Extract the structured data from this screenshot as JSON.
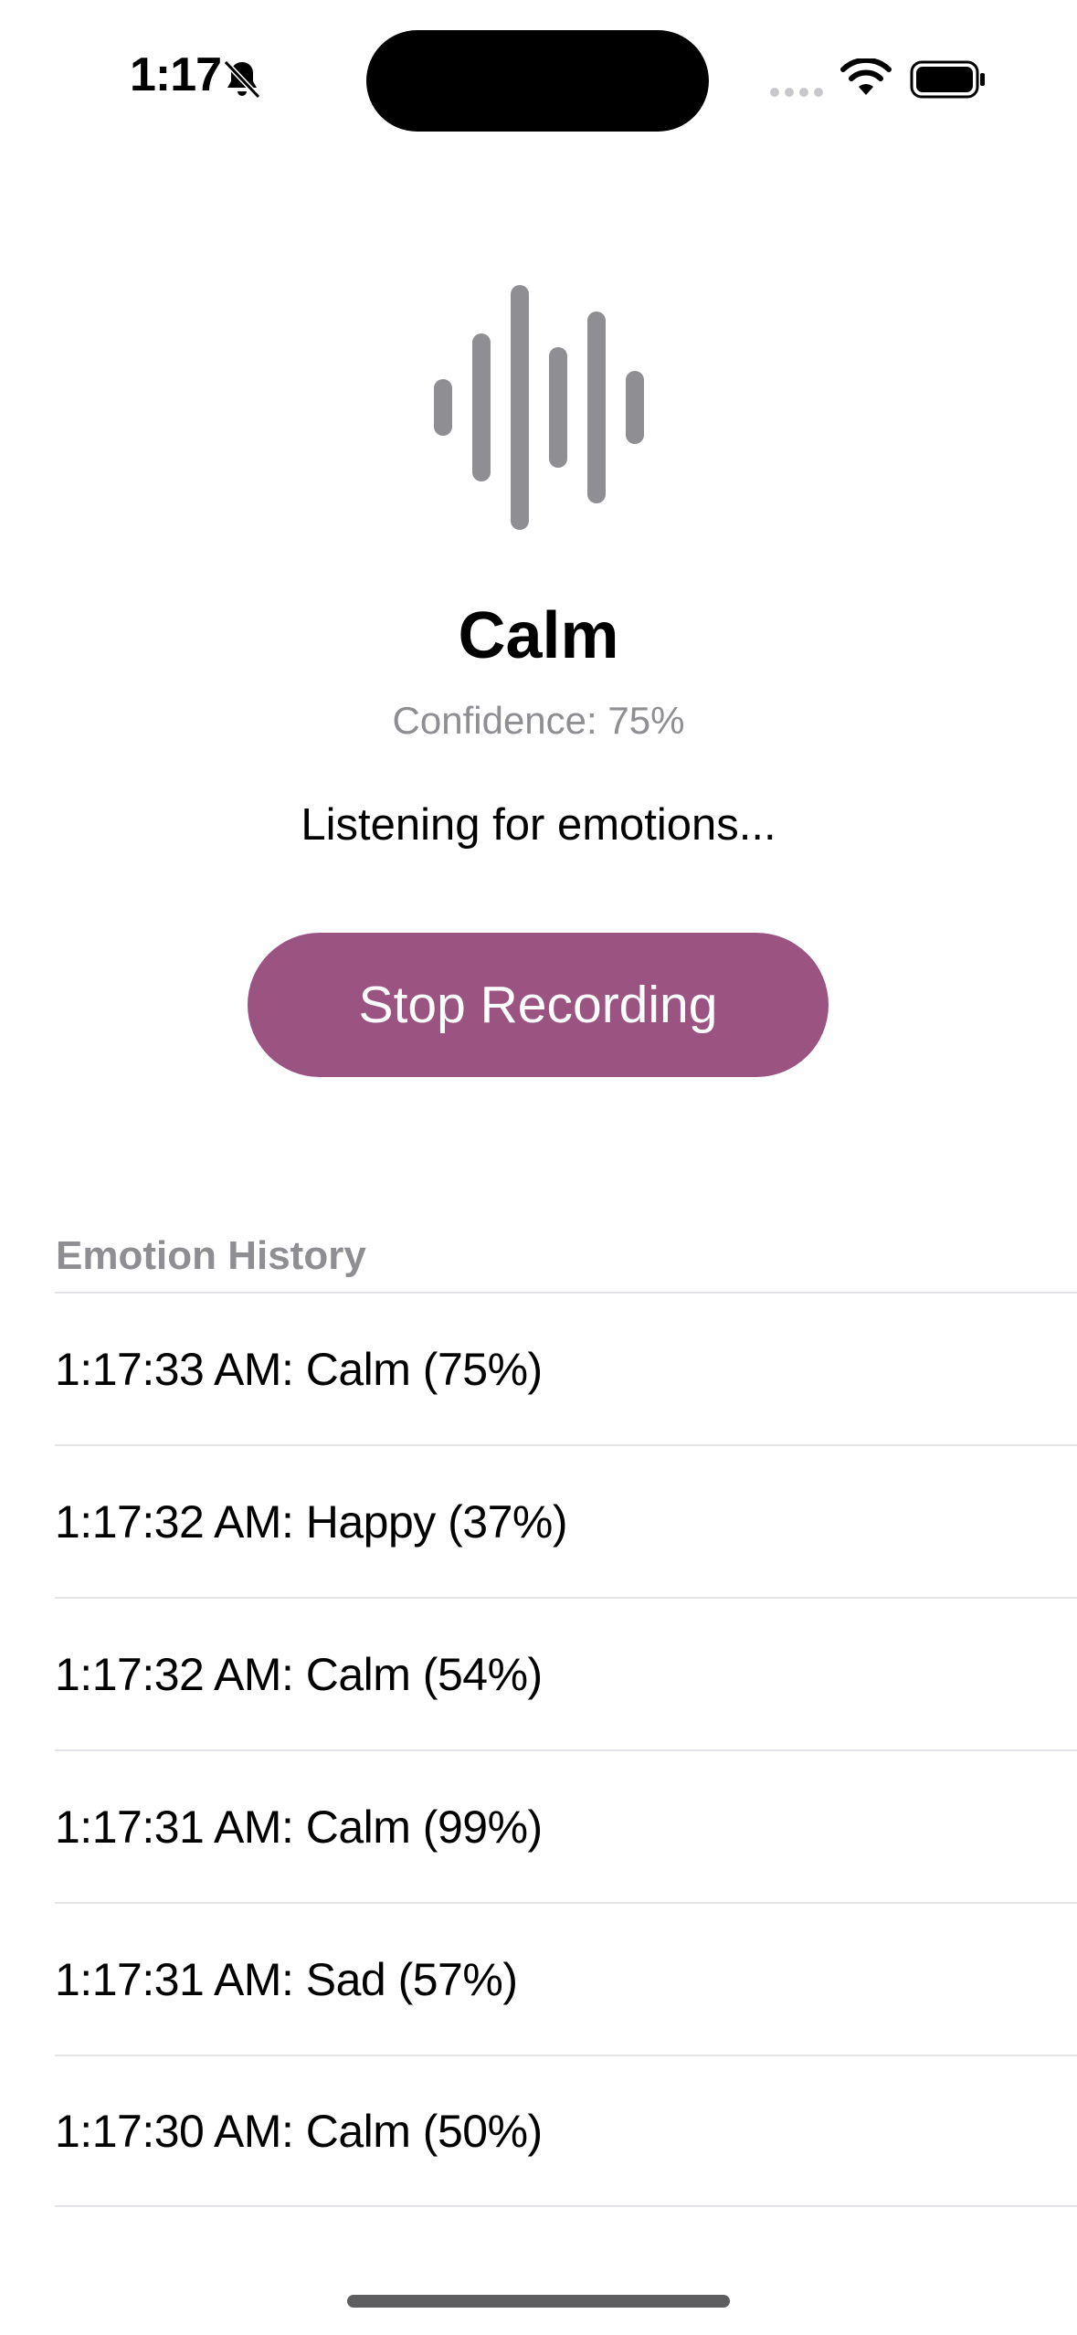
{
  "status_bar": {
    "time": "1:17",
    "icons": [
      "bell-slash-icon",
      "signal-icon",
      "wifi-icon",
      "battery-icon"
    ]
  },
  "main": {
    "icon": "waveform-icon",
    "emotion": "Calm",
    "confidence": "Confidence: 75%",
    "status": "Listening for emotions...",
    "button_label": "Stop Recording"
  },
  "history": {
    "title": "Emotion History",
    "items": [
      "1:17:33 AM: Calm (75%)",
      "1:17:32 AM: Happy (37%)",
      "1:17:32 AM: Calm (54%)",
      "1:17:31 AM: Calm (99%)",
      "1:17:31 AM: Sad (57%)",
      "1:17:30 AM: Calm (50%)"
    ]
  },
  "colors": {
    "accent": "#9b5482",
    "waveform": "#8e8e93",
    "secondary_text": "#8e8e93",
    "separator": "#e3e3e8"
  }
}
